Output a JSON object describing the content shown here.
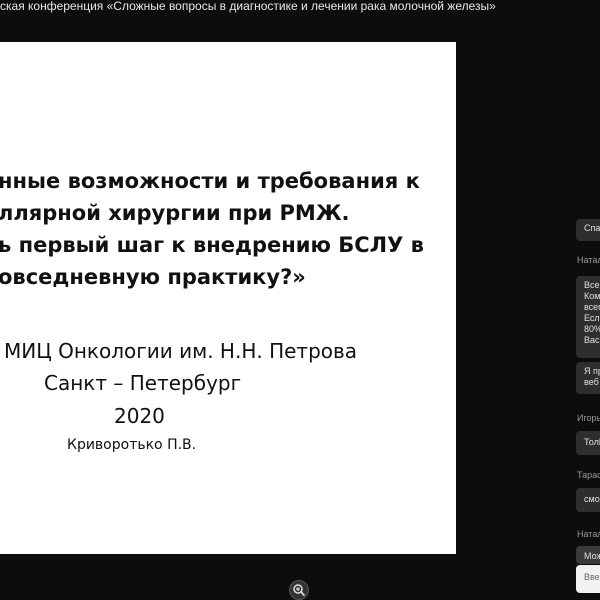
{
  "window": {
    "title": "ская конференция «Сложные вопросы в диагностике и лечении рака молочной железы»"
  },
  "slide": {
    "heading_lines": [
      "нные возможности и требования к",
      "ллярной хирургии при РМЖ.",
      "ь первый шаг к внедрению БСЛУ в",
      "овседневную практику?»"
    ],
    "institution": "МИЦ Онкологии им. Н.Н. Петрова",
    "city": "Санкт – Петербург",
    "year": "2020",
    "author": "Криворотько П.В."
  },
  "controls": {
    "zoom_icon": "zoom-in-icon"
  },
  "chat": {
    "messages": [
      {
        "sender": "",
        "lines": [
          "Спа"
        ]
      },
      {
        "sender": "Натал",
        "lines": [
          "Всег",
          "Ком",
          "всег",
          "Есл",
          "80%",
          "Вас"
        ]
      },
      {
        "sender": "",
        "lines": [
          "Я пр",
          "веб"
        ]
      },
      {
        "sender": "Игорь",
        "lines": [
          "Толl"
        ]
      },
      {
        "sender": "Тарас",
        "lines": [
          "смо"
        ]
      },
      {
        "sender": "Натал",
        "lines": [
          "Мож"
        ]
      }
    ],
    "input_placeholder": "Вве"
  }
}
